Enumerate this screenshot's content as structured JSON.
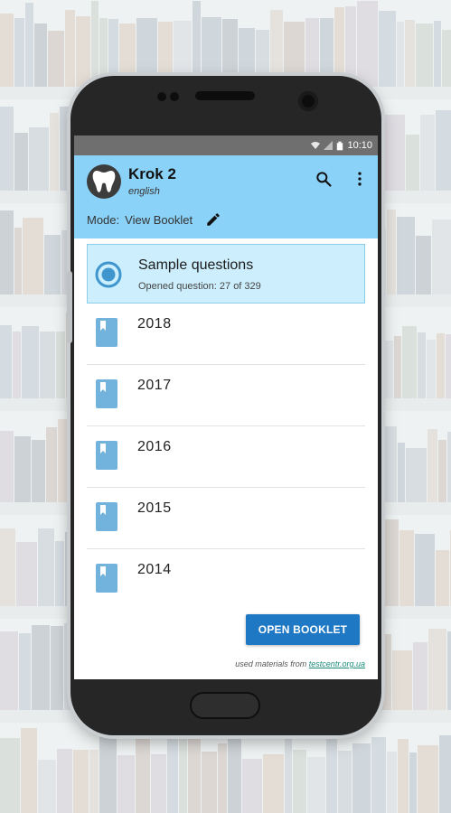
{
  "statusbar": {
    "time": "10:10"
  },
  "app": {
    "title": "Krok 2",
    "language": "english",
    "mode_label": "Mode:",
    "mode_value": "View Booklet"
  },
  "selected_item": {
    "title": "Sample questions",
    "subtitle": "Opened question: 27 of 329"
  },
  "years": [
    {
      "label": "2018"
    },
    {
      "label": "2017"
    },
    {
      "label": "2016"
    },
    {
      "label": "2015"
    },
    {
      "label": "2014"
    }
  ],
  "actions": {
    "open_booklet": "OPEN BOOKLET"
  },
  "footer": {
    "credit_prefix": "used materials from",
    "credit_link": "testcentr.org.ua"
  },
  "colors": {
    "appbar": "#8bd2f8",
    "selected_bg": "#cdeffd",
    "accent": "#1e78c4",
    "book_icon": "#72b3dd"
  },
  "icons": [
    "tooth-icon",
    "search-icon",
    "more-vert-icon",
    "pencil-icon",
    "radio-selected-icon",
    "book-icon",
    "wifi-icon",
    "signal-icon",
    "battery-icon"
  ]
}
